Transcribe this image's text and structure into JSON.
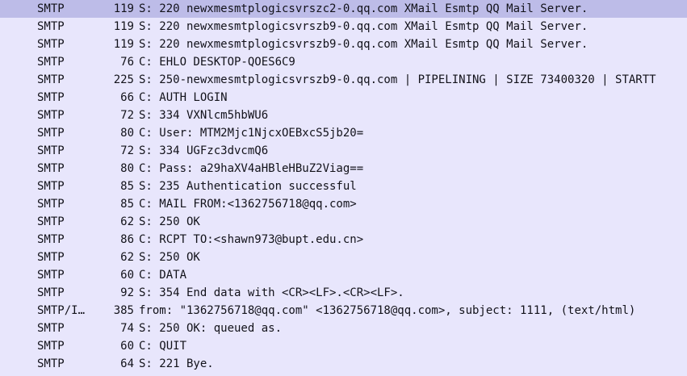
{
  "packet_list": {
    "rows": [
      {
        "protocol": "SMTP",
        "length": "119",
        "info": "S: 220 newxmesmtplogicsvrszc2-0.qq.com XMail Esmtp QQ Mail Server.",
        "selected": true
      },
      {
        "protocol": "SMTP",
        "length": "119",
        "info": "S: 220 newxmesmtplogicsvrszb9-0.qq.com XMail Esmtp QQ Mail Server."
      },
      {
        "protocol": "SMTP",
        "length": "119",
        "info": "S: 220 newxmesmtplogicsvrszb9-0.qq.com XMail Esmtp QQ Mail Server."
      },
      {
        "protocol": "SMTP",
        "length": "76",
        "info": "C: EHLO DESKTOP-QOES6C9"
      },
      {
        "protocol": "SMTP",
        "length": "225",
        "info": "S: 250-newxmesmtplogicsvrszb9-0.qq.com | PIPELINING | SIZE 73400320 | STARTT"
      },
      {
        "protocol": "SMTP",
        "length": "66",
        "info": "C: AUTH LOGIN"
      },
      {
        "protocol": "SMTP",
        "length": "72",
        "info": "S: 334 VXNlcm5hbWU6"
      },
      {
        "protocol": "SMTP",
        "length": "80",
        "info": "C: User: MTM2Mjc1NjcxOEBxcS5jb20="
      },
      {
        "protocol": "SMTP",
        "length": "72",
        "info": "S: 334 UGFzc3dvcmQ6"
      },
      {
        "protocol": "SMTP",
        "length": "80",
        "info": "C: Pass: a29haXV4aHBleHBuZ2Viag=="
      },
      {
        "protocol": "SMTP",
        "length": "85",
        "info": "S: 235 Authentication successful"
      },
      {
        "protocol": "SMTP",
        "length": "85",
        "info": "C: MAIL FROM:<1362756718@qq.com>"
      },
      {
        "protocol": "SMTP",
        "length": "62",
        "info": "S: 250 OK"
      },
      {
        "protocol": "SMTP",
        "length": "86",
        "info": "C: RCPT TO:<shawn973@bupt.edu.cn>"
      },
      {
        "protocol": "SMTP",
        "length": "62",
        "info": "S: 250 OK"
      },
      {
        "protocol": "SMTP",
        "length": "60",
        "info": "C: DATA"
      },
      {
        "protocol": "SMTP",
        "length": "92",
        "info": "S: 354 End data with <CR><LF>.<CR><LF>."
      },
      {
        "protocol": "SMTP/I…",
        "length": "385",
        "info": "from: \"1362756718@qq.com\" <1362756718@qq.com>, subject: 1111,  (text/html)"
      },
      {
        "protocol": "SMTP",
        "length": "74",
        "info": "S: 250 OK: queued as."
      },
      {
        "protocol": "SMTP",
        "length": "60",
        "info": "C: QUIT"
      },
      {
        "protocol": "SMTP",
        "length": "64",
        "info": "S: 221 Bye."
      }
    ]
  }
}
